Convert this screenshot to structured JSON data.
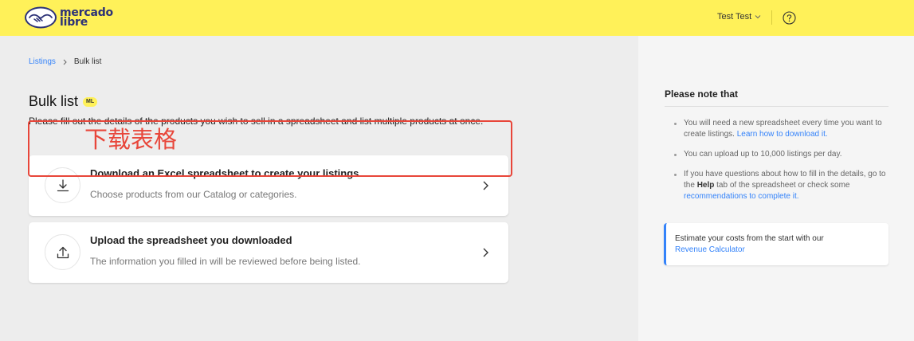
{
  "header": {
    "logo_line1": "mercado",
    "logo_line2": "libre",
    "user_name": "Test Test",
    "icons": [
      "handshake-logo-icon",
      "chevron-down-icon",
      "help-circle-icon"
    ]
  },
  "breadcrumb": {
    "parent": "Listings",
    "current": "Bulk list"
  },
  "page": {
    "title": "Bulk list",
    "badge": "ML",
    "subtitle": "Please fill out the details of the products you wish to sell in a spreadsheet and list multiple products at once.",
    "annotation": "下载表格"
  },
  "cards": [
    {
      "title": "Download an Excel spreadsheet to create your listings",
      "desc": "Choose products from our Catalog or categories.",
      "icon": "download-icon"
    },
    {
      "title": "Upload the spreadsheet you downloaded",
      "desc": "The information you filled in will be reviewed before being listed.",
      "icon": "upload-icon"
    }
  ],
  "sidebar": {
    "title": "Please note that",
    "notes": [
      {
        "text": "You will need a new spreadsheet every time you want to create listings.",
        "link": "Learn how to download it."
      },
      {
        "text": "You can upload up to 10,000 listings per day."
      },
      {
        "text_before": "If you have questions about how to fill in the details, go to the",
        "bold": "Help",
        "text_after": "tab of the spreadsheet or check some",
        "link": "recommendations to complete it."
      }
    ],
    "notice": {
      "text": "Estimate your costs from the start with our",
      "link": "Revenue Calculator"
    }
  },
  "colors": {
    "header_bg": "#fff159",
    "link": "#3483fa",
    "annotation_red": "#e8463a"
  }
}
